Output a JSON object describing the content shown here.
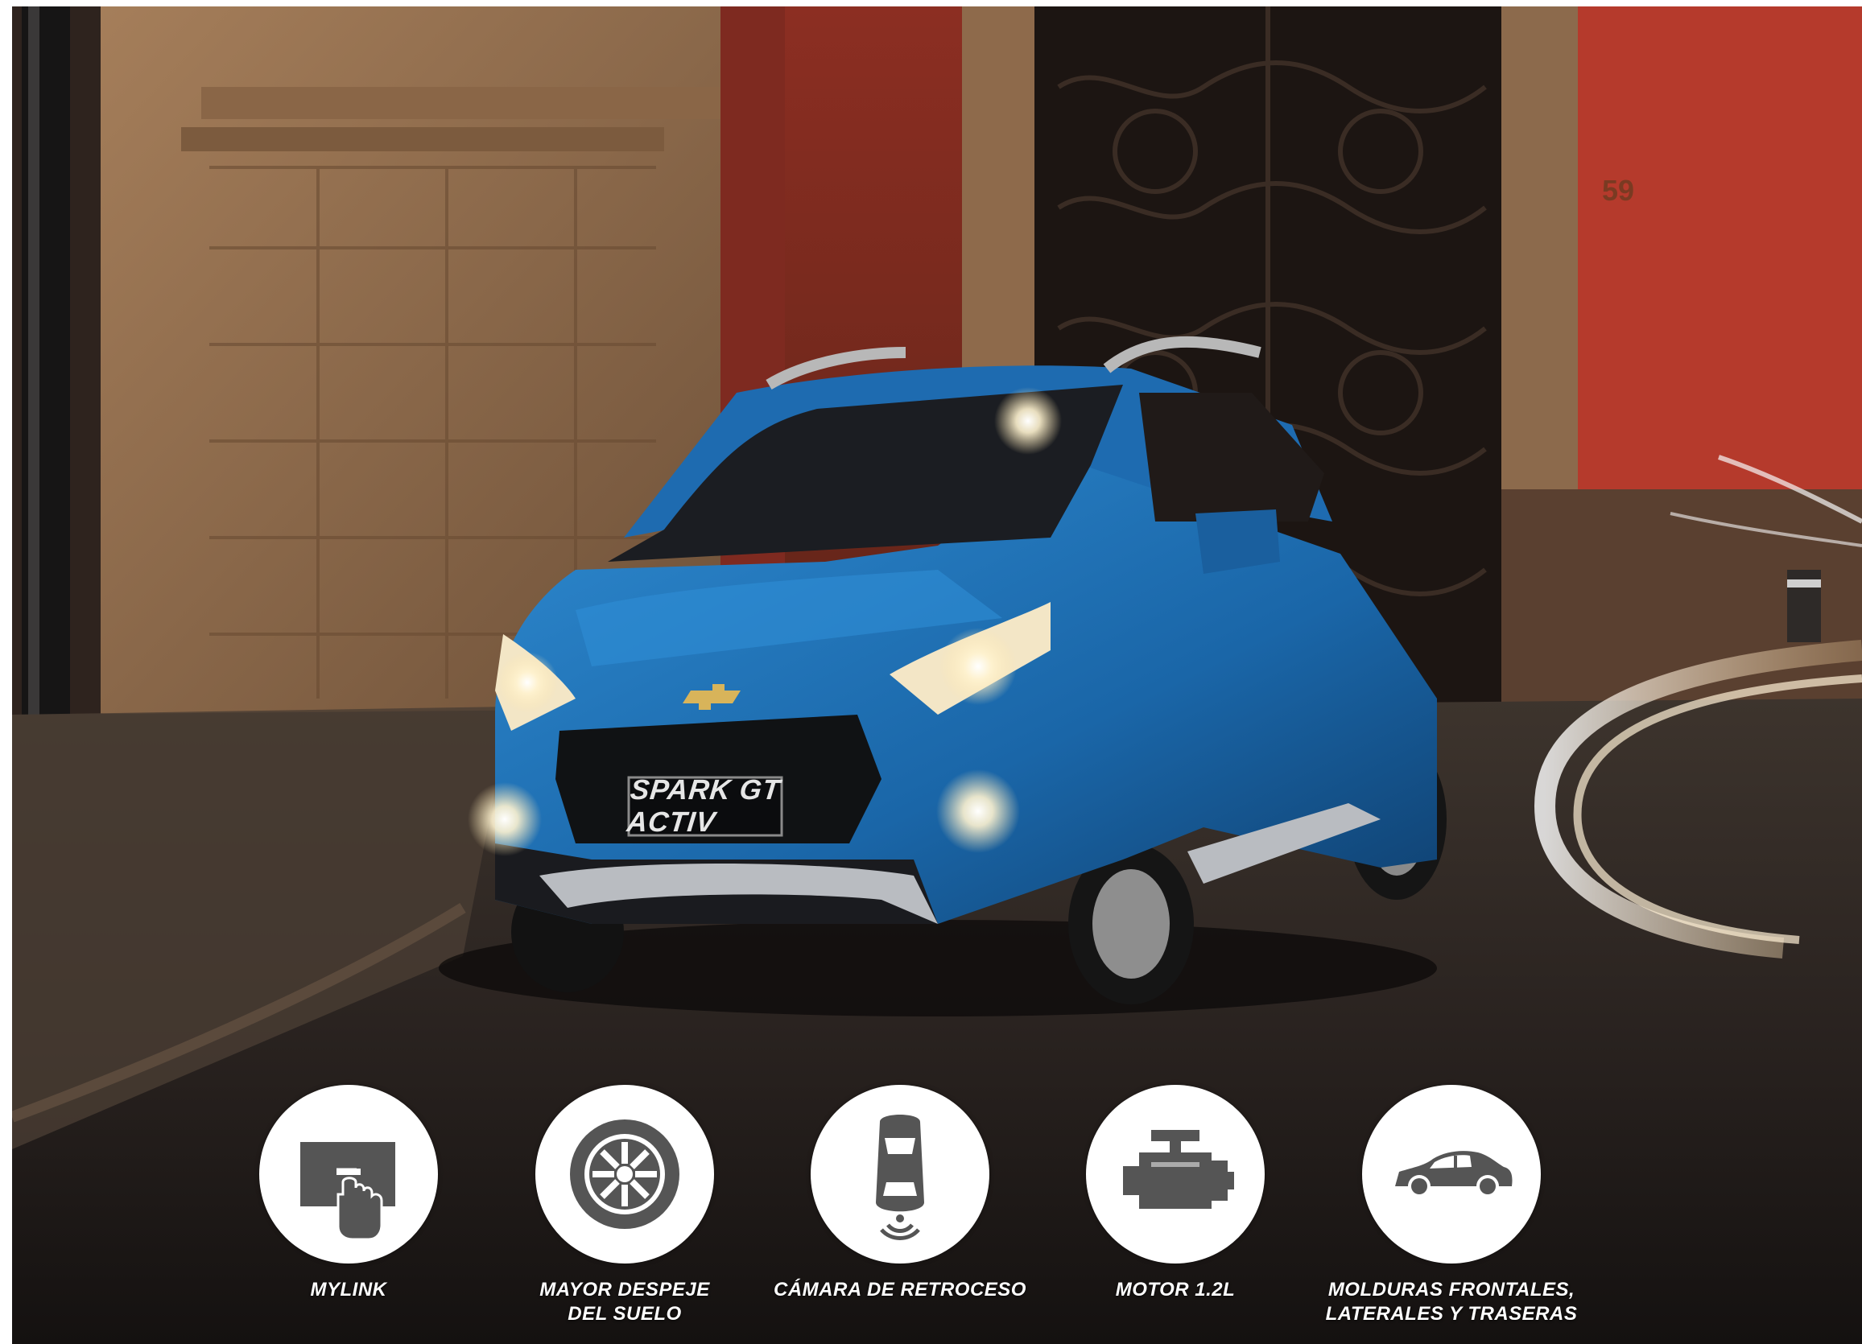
{
  "badge": {
    "model_plate": "SPARK GT ACTIV",
    "house_number": "59"
  },
  "features": [
    {
      "icon": "touchscreen-icon",
      "lines": [
        "MYLINK"
      ]
    },
    {
      "icon": "wheel-icon",
      "lines": [
        "MAYOR DESPEJE",
        "DEL SUELO"
      ]
    },
    {
      "icon": "rear-camera-car-icon",
      "lines": [
        "CÁMARA DE RETROCESO"
      ]
    },
    {
      "icon": "engine-icon",
      "lines": [
        "MOTOR 1.2L"
      ]
    },
    {
      "icon": "sedan-car-icon",
      "lines": [
        "MOLDURAS FRONTALES,",
        "LATERALES Y TRASERAS"
      ]
    }
  ],
  "colors": {
    "car_body": "#1f73b7",
    "wall_red": "#a8342a",
    "stone": "#9a7452",
    "icon_gray": "#555555",
    "label_text": "#ffffff"
  }
}
